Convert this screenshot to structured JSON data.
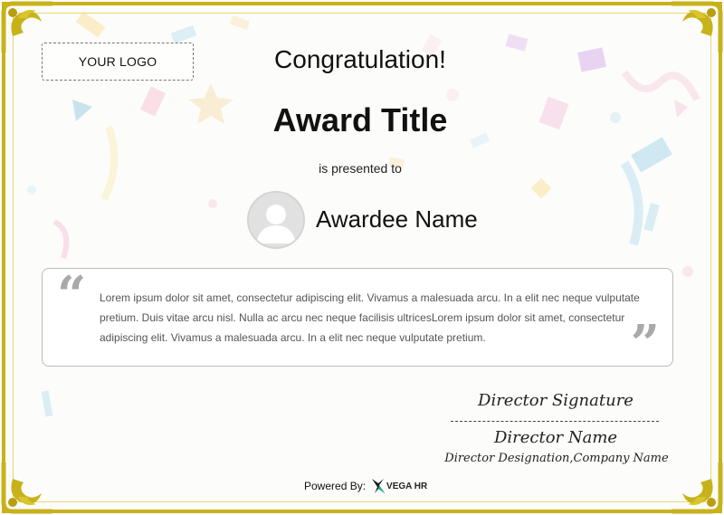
{
  "certificate": {
    "logo_text": "YOUR LOGO",
    "heading": "Congratulation!",
    "award_title": "Award Title",
    "presented_to": "is presented to",
    "awardee_name": "Awardee Name",
    "quote_text": "Lorem ipsum dolor sit amet, consectetur adipiscing elit. Vivamus a malesuada arcu. In a elit nec neque vulputate pretium. Duis vitae arcu nisl. Nulla ac arcu nec neque facilisis ultricesLorem ipsum dolor sit amet, consectetur adipiscing elit. Vivamus a malesuada arcu. In a elit nec neque vulputate pretium.",
    "director_signature": "Director Signature",
    "director_name": "Director Name",
    "director_designation": "Director Designation,Company Name",
    "powered_by_label": "Powered By:",
    "powered_by_brand": "VEGA HR"
  },
  "colors": {
    "border_gold": "#c8b21a",
    "quote_mark_gray": "#a9a9a9",
    "text_dark": "#111111"
  },
  "icons": {
    "avatar": "user-silhouette-icon",
    "quote_open": "quote-open-icon",
    "quote_close": "quote-close-icon",
    "brand": "vega-hr-logo-icon",
    "corner": "ornamental-corner-icon"
  }
}
